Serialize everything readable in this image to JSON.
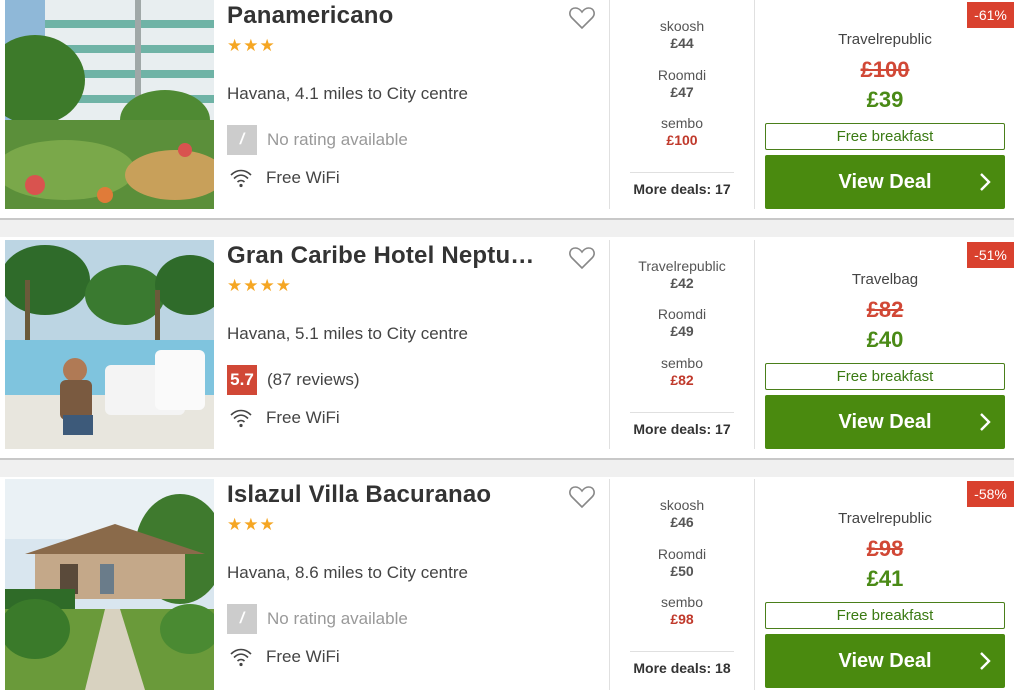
{
  "hotels": [
    {
      "name": "Panamericano",
      "stars_text": "★★★",
      "stars": 3,
      "location": "Havana, 4.1 miles to City centre",
      "rating_value": "/",
      "rating_text": "No rating available",
      "amenity": "Free WiFi",
      "other_deals": [
        {
          "provider": "skoosh",
          "price": "£44"
        },
        {
          "provider": "Roomdi",
          "price": "£47"
        },
        {
          "provider": "sembo",
          "price": "£100"
        }
      ],
      "more_deals": "More deals: 17",
      "discount": "-61%",
      "best_provider": "Travelrepublic",
      "old_price": "£100",
      "new_price": "£39",
      "perk": "Free breakfast",
      "cta": "View Deal"
    },
    {
      "name": "Gran Caribe Hotel Neptu…",
      "stars_text": "★★★★",
      "stars": 4,
      "location": "Havana, 5.1 miles to City centre",
      "rating_value": "5.7",
      "rating_text": "(87 reviews)",
      "amenity": "Free WiFi",
      "other_deals": [
        {
          "provider": "Travelrepublic",
          "price": "£42"
        },
        {
          "provider": "Roomdi",
          "price": "£49"
        },
        {
          "provider": "sembo",
          "price": "£82"
        }
      ],
      "more_deals": "More deals: 17",
      "discount": "-51%",
      "best_provider": "Travelbag",
      "old_price": "£82",
      "new_price": "£40",
      "perk": "Free breakfast",
      "cta": "View Deal"
    },
    {
      "name": "Islazul Villa Bacuranao",
      "stars_text": "★★★",
      "stars": 3,
      "location": "Havana, 8.6 miles to City centre",
      "rating_value": "/",
      "rating_text": "No rating available",
      "amenity": "Free WiFi",
      "other_deals": [
        {
          "provider": "skoosh",
          "price": "£46"
        },
        {
          "provider": "Roomdi",
          "price": "£50"
        },
        {
          "provider": "sembo",
          "price": "£98"
        }
      ],
      "more_deals": "More deals: 18",
      "discount": "-58%",
      "best_provider": "Travelrepublic",
      "old_price": "£98",
      "new_price": "£41",
      "perk": "Free breakfast",
      "cta": "View Deal"
    }
  ],
  "colors": {
    "accent_green": "#4a8a0f",
    "price_green": "#4a8a16",
    "price_red": "#d14836",
    "badge_red": "#d9412e",
    "star_orange": "#f5a623",
    "rating_red": "#d14836"
  },
  "icons": {
    "favorite": "heart-outline-icon",
    "wifi": "wifi-icon",
    "cta_arrow": "chevron-right-icon",
    "photo": "hotel-photo"
  }
}
